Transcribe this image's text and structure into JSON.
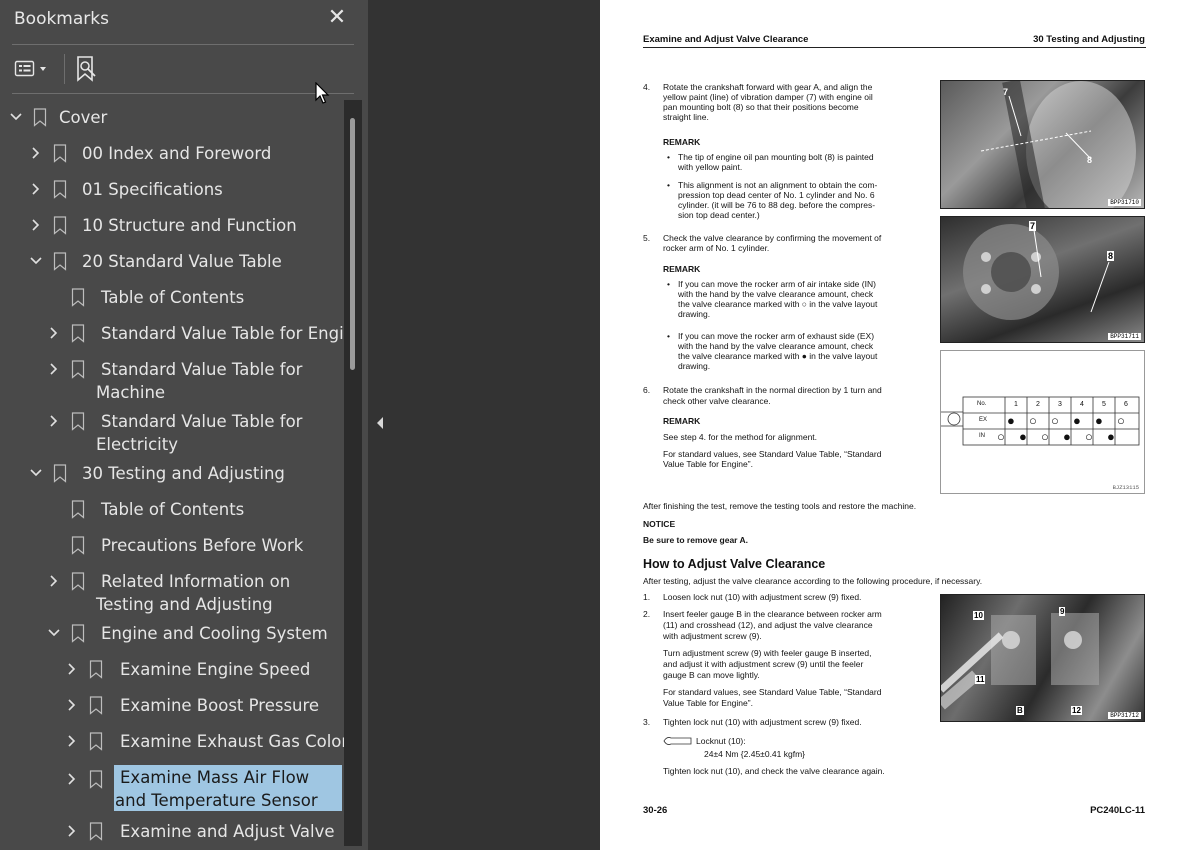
{
  "bookmarks": {
    "title": "Bookmarks",
    "close_glyph": "✕",
    "tools": [
      {
        "name": "options-menu-icon",
        "glyph": "▾"
      },
      {
        "name": "find-bookmark-icon",
        "glyph": ""
      }
    ],
    "items": [
      {
        "label": "Cover",
        "expanded": true,
        "has_children": true
      },
      {
        "label": "00 Index and Foreword",
        "expanded": false,
        "has_children": true
      },
      {
        "label": "01 Specifications",
        "expanded": false,
        "has_children": true
      },
      {
        "label": "10 Structure and Function",
        "expanded": false,
        "has_children": true
      },
      {
        "label": "20 Standard Value Table",
        "expanded": true,
        "has_children": true
      },
      {
        "label": "Table of Contents",
        "has_children": false
      },
      {
        "label": "Standard Value Table for Engine",
        "expanded": false,
        "has_children": true
      },
      {
        "label": "Standard Value Table for Machine",
        "expanded": false,
        "has_children": true
      },
      {
        "label": "Standard Value Table for Electricity",
        "expanded": false,
        "has_children": true
      },
      {
        "label": "30 Testing and Adjusting",
        "expanded": true,
        "has_children": true
      },
      {
        "label": "Table of Contents",
        "has_children": false
      },
      {
        "label": "Precautions Before Work",
        "has_children": false
      },
      {
        "label": "Related Information on Testing and Adjusting",
        "expanded": false,
        "has_children": true
      },
      {
        "label": "Engine and Cooling System",
        "expanded": true,
        "has_children": true
      },
      {
        "label": "Examine Engine Speed",
        "expanded": false,
        "has_children": true
      },
      {
        "label": "Examine Boost Pressure",
        "expanded": false,
        "has_children": true
      },
      {
        "label": "Examine Exhaust Gas Color",
        "expanded": false,
        "has_children": true
      },
      {
        "label": "Examine Mass Air Flow and Temperature Sensor",
        "expanded": false,
        "has_children": true,
        "selected": true
      },
      {
        "label": "Examine and Adjust Valve",
        "expanded": false,
        "has_children": true
      }
    ]
  },
  "page": {
    "header_left": "Examine and Adjust Valve Clearance",
    "header_right": "30 Testing and Adjusting",
    "step4_num": "4.",
    "step4_l1": "Rotate the crankshaft forward with gear A, and align the",
    "step4_l2": "yellow paint (line) of vibration damper (7) with engine oil",
    "step4_l3": "pan mounting bolt (8) so that their positions become",
    "step4_l4": "straight line.",
    "remark": "REMARK",
    "bullet": "•",
    "r1_l1": "The tip of engine oil pan mounting bolt (8) is painted",
    "r1_l2": "with yellow paint.",
    "r2_l1": "This alignment is not an alignment to obtain the com-",
    "r2_l2": "pression top dead center of No. 1 cylinder and No. 6",
    "r2_l3": "cylinder. (it will be 76 to 88 deg. before the compres-",
    "r2_l4": "sion top dead center.)",
    "step5_num": "5.",
    "step5_l1": "Check the valve clearance by confirming the movement of",
    "step5_l2": "rocker arm of No. 1 cylinder.",
    "r3_l1": "If you can move the rocker arm of air intake side (IN)",
    "r3_l2": "with the hand by the valve clearance amount, check",
    "r3_l3": "the valve clearance marked with ○ in the valve layout",
    "r3_l4": "drawing.",
    "r4_l1": "If you can move the rocker arm of exhaust side (EX)",
    "r4_l2": "with the hand by the valve clearance amount, check",
    "r4_l3": "the valve clearance marked with ● in the valve layout",
    "r4_l4": "drawing.",
    "step6_num": "6.",
    "step6_l1": "Rotate the crankshaft in the normal direction by 1 turn and",
    "step6_l2": "check other valve clearance.",
    "see_step": "See step 4. for the method for alignment.",
    "std_l1": "For standard values, see Standard Value Table, “Standard",
    "std_l2": "Value Table for Engine”.",
    "after_test": "After finishing the test, remove the testing tools and restore the machine.",
    "notice": "NOTICE",
    "remove_gear": "Be sure to remove gear A.",
    "h_adjust": "How to Adjust Valve Clearance",
    "adj_intro": "After testing, adjust the valve clearance according to the following procedure, if necessary.",
    "a1_num": "1.",
    "a1": "Loosen lock nut (10) with adjustment screw (9) fixed.",
    "a2_num": "2.",
    "a2_l1": "Insert feeler gauge B in the clearance between rocker arm",
    "a2_l2": "(11) and crosshead (12), and adjust the valve clearance",
    "a2_l3": "with adjustment screw (9).",
    "a2b_l1": "Turn adjustment screw (9) with feeler gauge B inserted,",
    "a2b_l2": "and adjust it with adjustment screw (9) until the feeler",
    "a2b_l3": "gauge B can move lightly.",
    "a3_num": "3.",
    "a3": "Tighten lock nut (10) with adjustment screw (9) fixed.",
    "locknut": "Locknut (10):",
    "torque": "24±4 Nm {2.45±0.41 kgfm}",
    "tighten_again": "Tighten lock nut (10), and check the valve clearance again.",
    "footer_left": "30-26",
    "footer_right": "PC240LC-11",
    "photo1_tag": "BPP31710",
    "photo2_tag": "BPP31711",
    "photo3_tag": "BPP31712",
    "diagram_tag": "BJZ13115",
    "callouts": {
      "n7": "7",
      "n8": "8",
      "n9": "9",
      "n10": "10",
      "n11": "11",
      "n12": "12",
      "nB": "B"
    },
    "valve_table": {
      "header": [
        "No.",
        "1",
        "2",
        "3",
        "4",
        "5",
        "6"
      ],
      "rows": [
        {
          "label": "EX",
          "marks": [
            "●",
            "○",
            "○",
            "●",
            "●",
            "○"
          ]
        },
        {
          "label": "IN",
          "marks": [
            "○",
            "●",
            "○",
            "●",
            "○",
            "●"
          ]
        }
      ]
    }
  }
}
